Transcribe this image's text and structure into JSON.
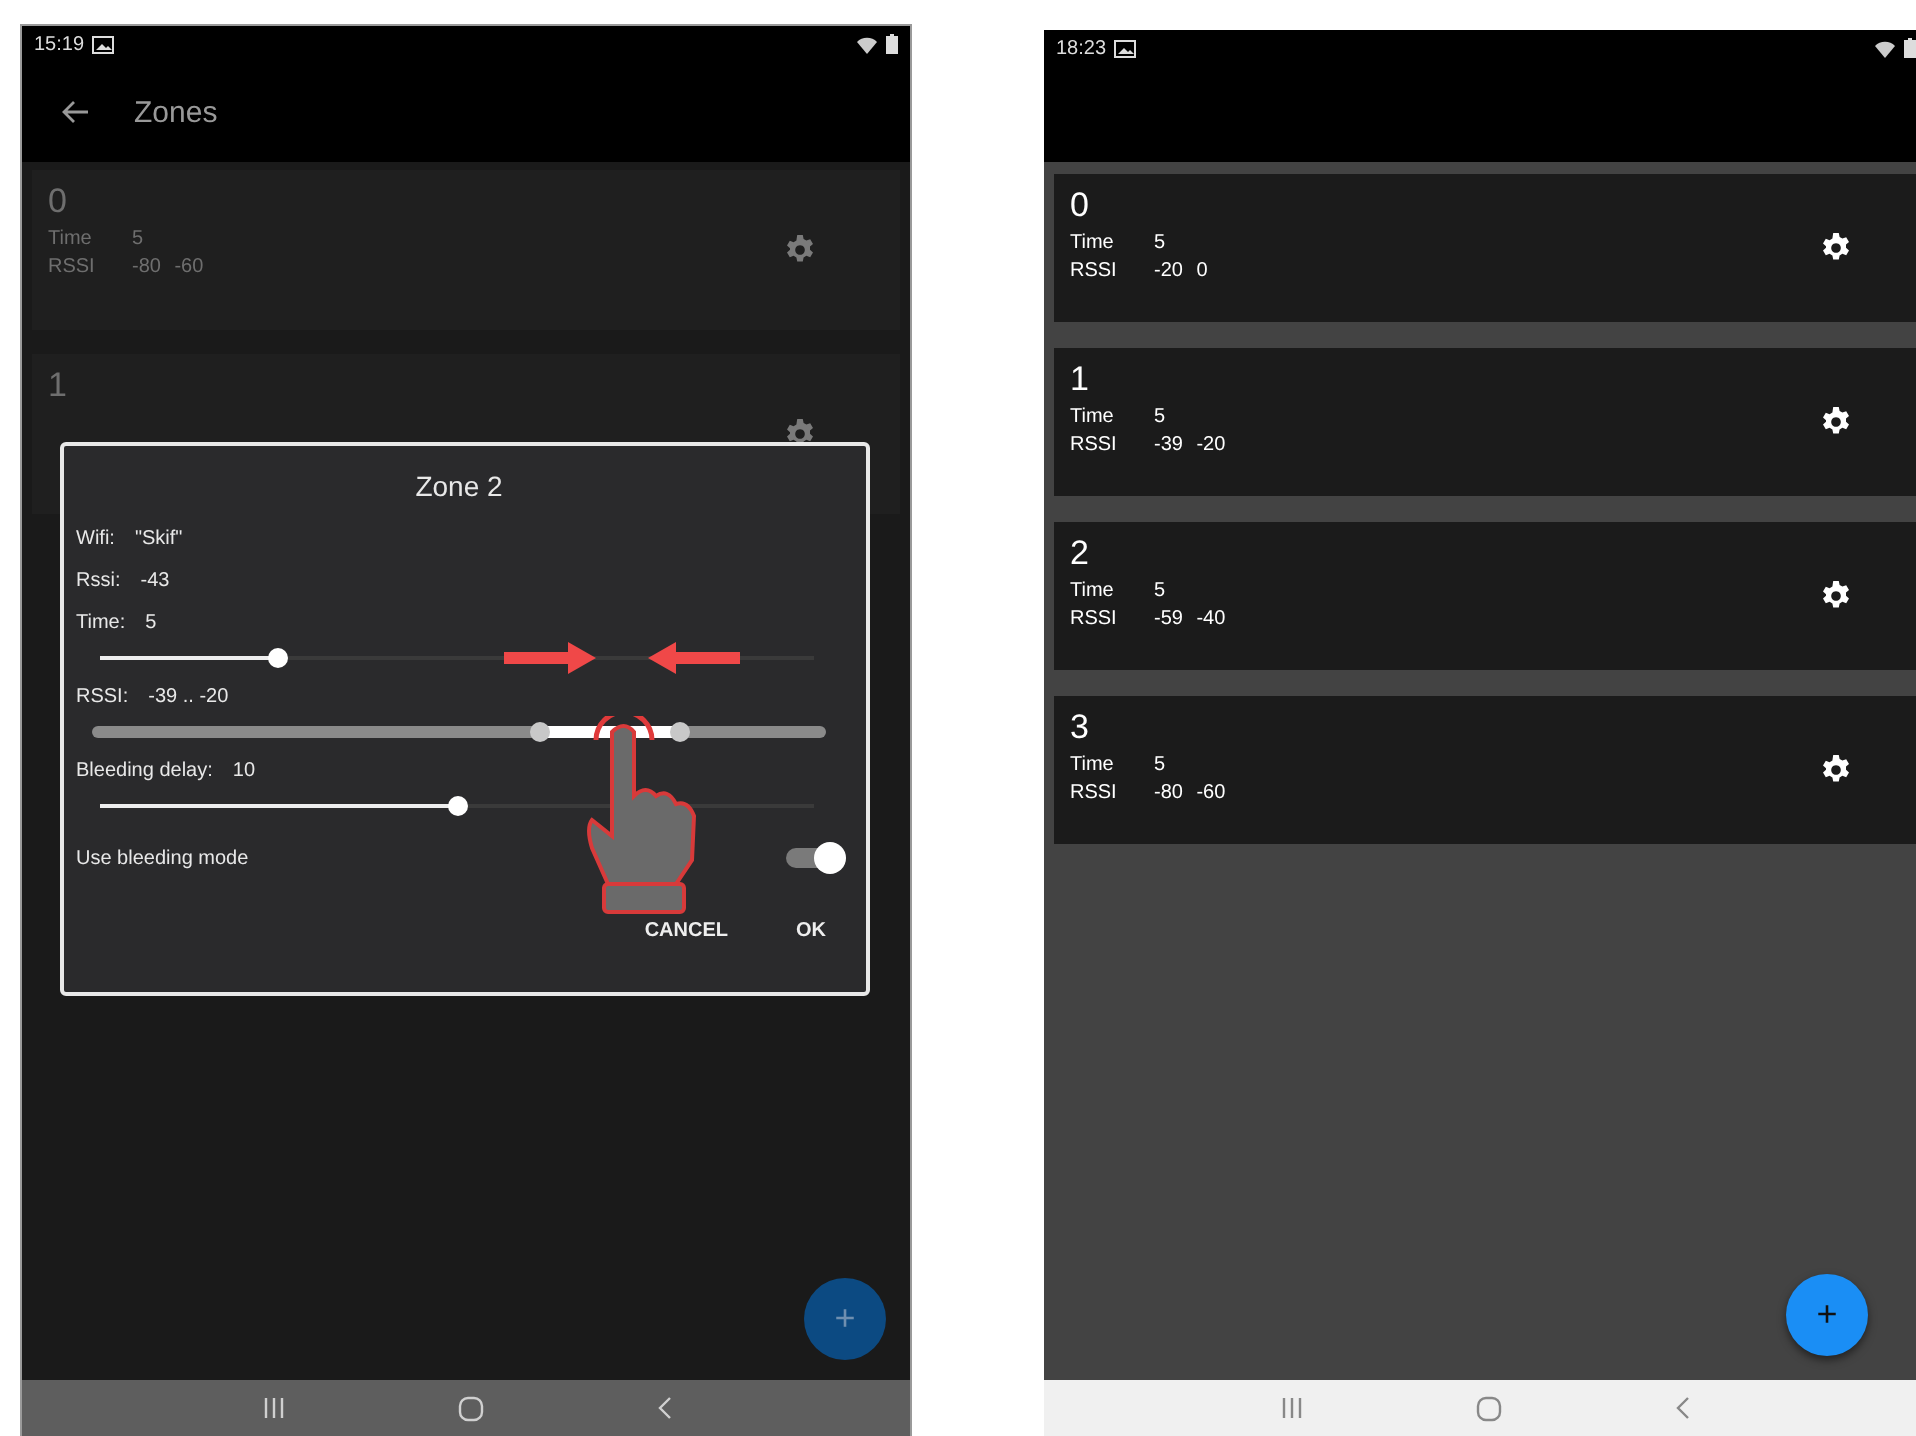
{
  "screens": [
    {
      "kind": "dimmed",
      "status_bar": {
        "time": "15:19"
      },
      "app_bar": {
        "title": "Zones"
      },
      "zones": [
        {
          "number": "0",
          "time_label": "Time",
          "time": "5",
          "rssi_label": "RSSI",
          "rssi": "-80 -60"
        },
        {
          "number": "1"
        }
      ],
      "dialog": {
        "title": "Zone 2",
        "info": [
          {
            "label": "Wifi:",
            "value": "\"Skif\""
          },
          {
            "label": "Rssi:",
            "value": "-43"
          }
        ],
        "settings": [
          {
            "kind": "slider",
            "label": "Time:",
            "value": "5",
            "level": 0.25
          },
          {
            "kind": "range",
            "label": "RSSI:",
            "value": "-39 .. -20",
            "thumbs": [
              {
                "level": 0.61
              },
              {
                "level": 0.8
              }
            ]
          },
          {
            "kind": "slider",
            "label": "Bleeding delay:",
            "value": "10",
            "level": 0.5
          },
          {
            "kind": "switch",
            "label": "Use bleeding mode",
            "on": true
          }
        ],
        "buttons": [
          "CANCEL",
          "OK"
        ]
      },
      "fab": {
        "label": "+"
      }
    },
    {
      "kind": "normal",
      "status_bar": {
        "time": "18:23"
      },
      "zones": [
        {
          "number": "0",
          "time_label": "Time",
          "time": "5",
          "rssi_label": "RSSI",
          "rssi": "-20 0"
        },
        {
          "number": "1",
          "time_label": "Time",
          "time": "5",
          "rssi_label": "RSSI",
          "rssi": "-39 -20"
        },
        {
          "number": "2",
          "time_label": "Time",
          "time": "5",
          "rssi_label": "RSSI",
          "rssi": "-59 -40"
        },
        {
          "number": "3",
          "time_label": "Time",
          "time": "5",
          "rssi_label": "RSSI",
          "rssi": "-80 -60"
        }
      ],
      "fab": {
        "label": "+"
      }
    }
  ]
}
